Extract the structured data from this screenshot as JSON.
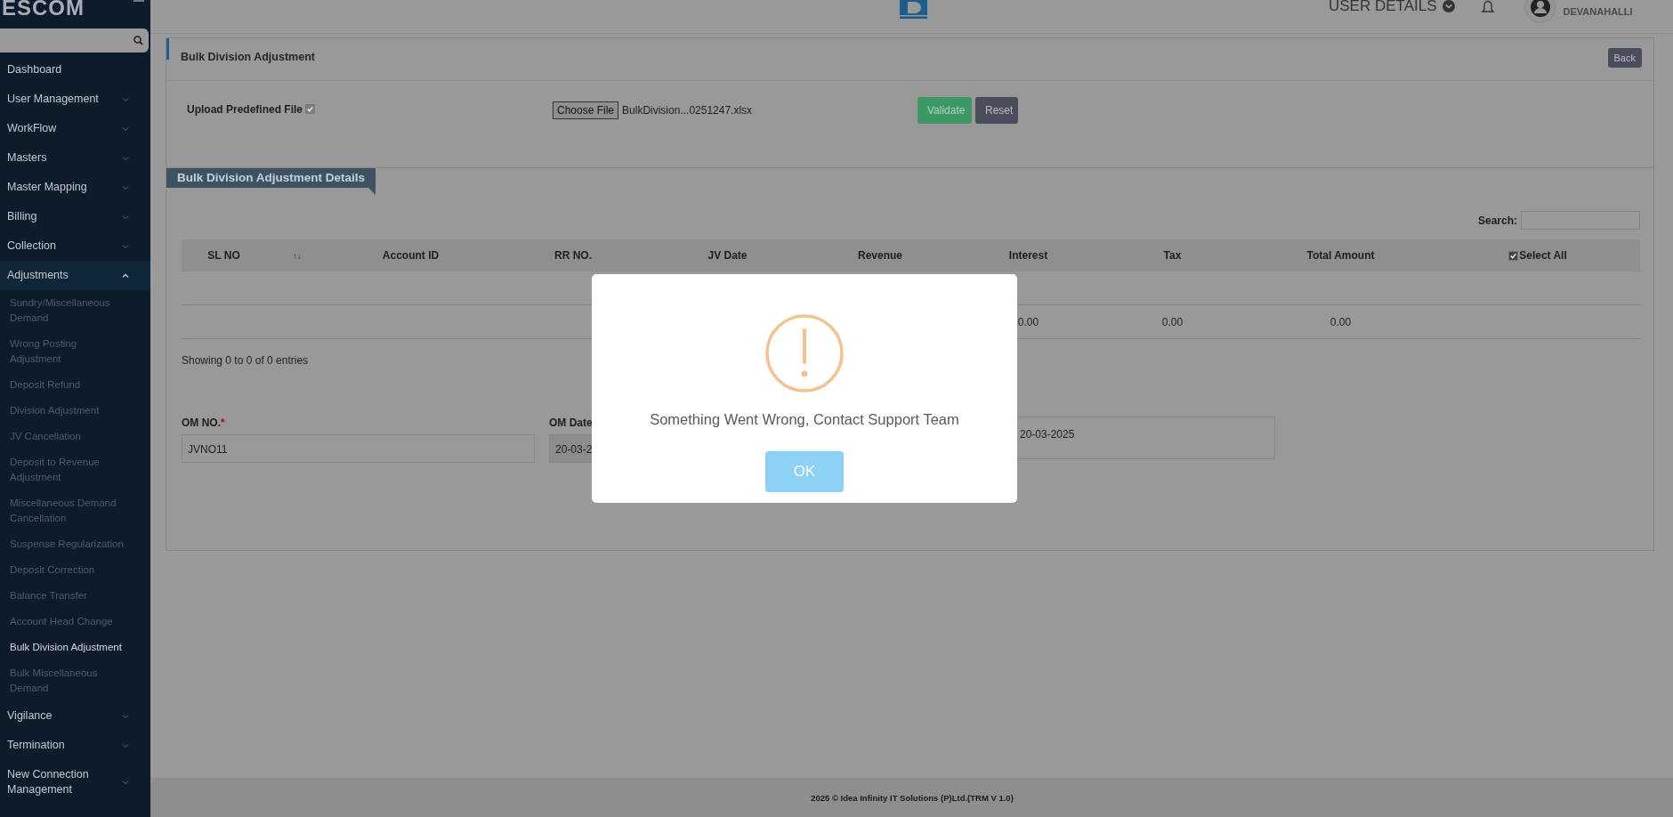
{
  "sidebar": {
    "brand": "ESCOM",
    "items": [
      {
        "kind": "link",
        "label": "Dashboard"
      },
      {
        "kind": "group",
        "label": "User Management",
        "expanded": false
      },
      {
        "kind": "group",
        "label": "WorkFlow",
        "expanded": false
      },
      {
        "kind": "group",
        "label": "Masters",
        "expanded": false
      },
      {
        "kind": "group",
        "label": "Master Mapping",
        "expanded": false
      },
      {
        "kind": "group",
        "label": "Billing",
        "expanded": false
      },
      {
        "kind": "group",
        "label": "Collection",
        "expanded": false
      },
      {
        "kind": "group",
        "label": "Adjustments",
        "expanded": true,
        "children": [
          {
            "label": "Sundry/Miscellaneous Demand",
            "selected": false
          },
          {
            "label": "Wrong Posting Adjustment",
            "selected": false
          },
          {
            "label": "Deposit Refund",
            "selected": false
          },
          {
            "label": "Division Adjustment",
            "selected": false
          },
          {
            "label": "JV Cancellation",
            "selected": false
          },
          {
            "label": "Deposit to Revenue Adjustment",
            "selected": false
          },
          {
            "label": "Miscellaneous Demand Cancellation",
            "selected": false
          },
          {
            "label": "Suspense Regularization",
            "selected": false
          },
          {
            "label": "Deposit Correction",
            "selected": false
          },
          {
            "label": "Balance Transfer",
            "selected": false
          },
          {
            "label": "Account Head Change",
            "selected": false
          },
          {
            "label": "Bulk Division Adjustment",
            "selected": true
          },
          {
            "label": "Bulk Miscellaneous Demand",
            "selected": false
          }
        ]
      },
      {
        "kind": "group",
        "label": "Vigilance",
        "expanded": false
      },
      {
        "kind": "group",
        "label": "Termination",
        "expanded": false
      },
      {
        "kind": "group",
        "label": "New Connection Management",
        "expanded": false
      }
    ]
  },
  "header": {
    "user_menu": "USER DETAILS",
    "location": "DEVANAHALLI"
  },
  "page": {
    "title": "Bulk Division Adjustment",
    "back": "Back",
    "upload": {
      "label": "Upload Predefined File",
      "checked": true,
      "disabled": true,
      "choose_button": "Choose File",
      "file_name": "BulkDivision...0251247.xlsx"
    },
    "validate": "Validate",
    "reset": "Reset"
  },
  "details": {
    "title": "Bulk Division Adjustment Details",
    "search_label": "Search:",
    "columns": [
      {
        "label": "SL NO",
        "sort_mark": "↑↓"
      },
      {
        "label": "Account ID"
      },
      {
        "label": "RR NO."
      },
      {
        "label": "JV Date"
      },
      {
        "label": "Revenue"
      },
      {
        "label": "Interest",
        "total": "0.00"
      },
      {
        "label": "Tax",
        "total": "0.00"
      },
      {
        "label": "Total Amount",
        "total": "0.00"
      },
      {
        "label": "Select All",
        "kind": "checkbox",
        "checked": true
      }
    ],
    "info": "Showing 0 to 0 of 0 entries"
  },
  "form": {
    "fields": [
      {
        "label": "OM NO.",
        "required_mark": "*",
        "value": "JVNO11",
        "readonly": false
      },
      {
        "label": "OM Date",
        "value": "20-03-2",
        "readonly": true
      },
      {
        "value": "20-03-2025",
        "readonly": false
      }
    ]
  },
  "modal": {
    "message": "Something Went Wrong, Contact Support Team",
    "ok": "OK"
  },
  "footer": {
    "text": "2025 © Idea Infinity IT Solutions (P)Ltd.(TRM V 1.0)"
  }
}
